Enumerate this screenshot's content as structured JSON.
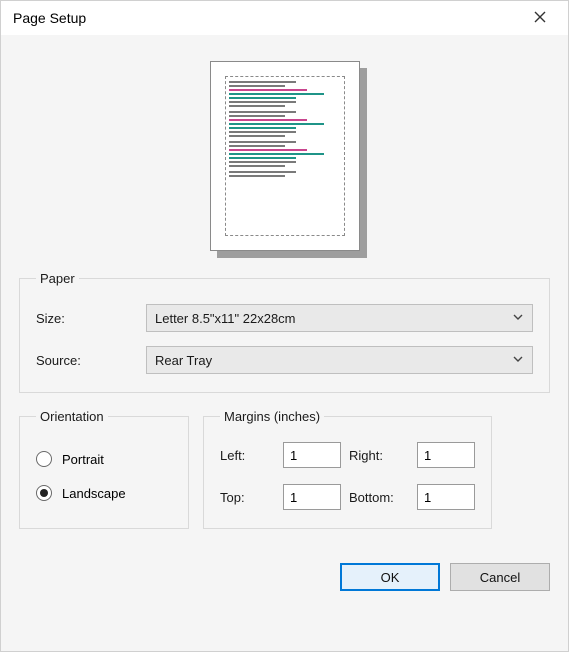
{
  "window": {
    "title": "Page Setup"
  },
  "paper": {
    "legend": "Paper",
    "size_label": "Size:",
    "size_value": "Letter 8.5\"x11\" 22x28cm",
    "source_label": "Source:",
    "source_value": "Rear Tray"
  },
  "orientation": {
    "legend": "Orientation",
    "portrait_label": "Portrait",
    "landscape_label": "Landscape",
    "selected": "landscape"
  },
  "margins": {
    "legend": "Margins (inches)",
    "left_label": "Left:",
    "right_label": "Right:",
    "top_label": "Top:",
    "bottom_label": "Bottom:",
    "left": "1",
    "right": "1",
    "top": "1",
    "bottom": "1"
  },
  "buttons": {
    "ok": "OK",
    "cancel": "Cancel"
  }
}
